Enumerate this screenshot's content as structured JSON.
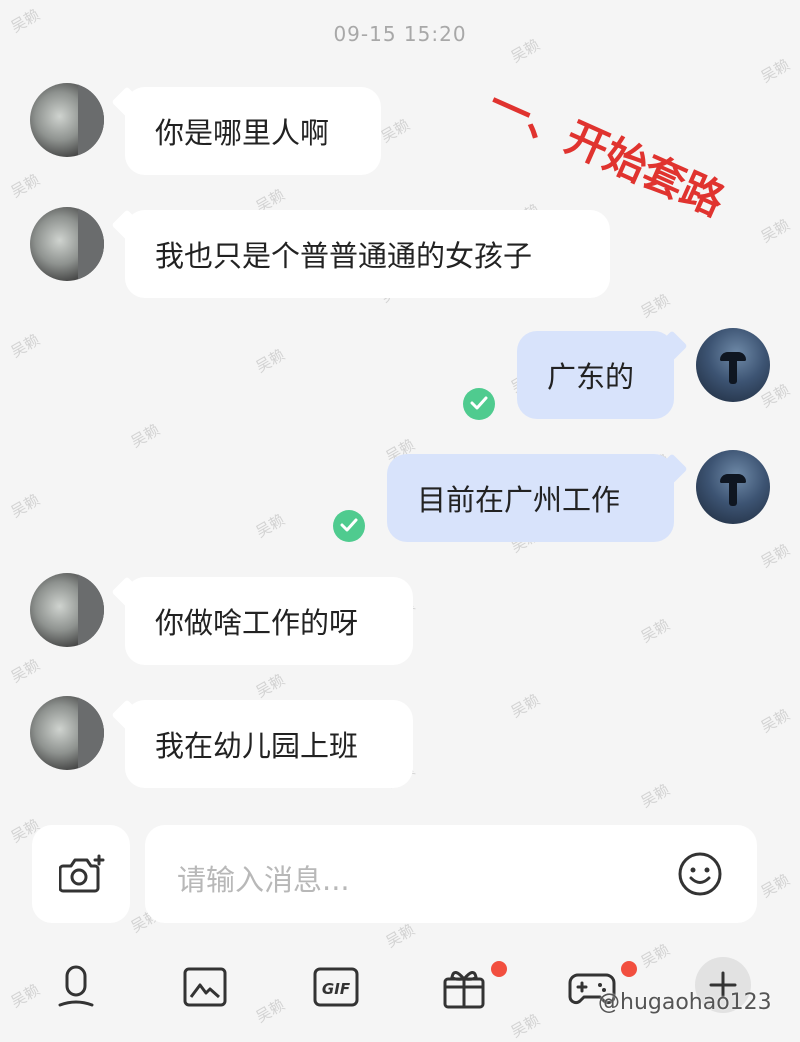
{
  "chat": {
    "timestamp": "09-15 15:20",
    "messages": [
      {
        "from": "them",
        "text": "你是哪里人啊"
      },
      {
        "from": "them",
        "text": "我也只是个普普通通的女孩子"
      },
      {
        "from": "me",
        "text": "广东的",
        "status": "read"
      },
      {
        "from": "me",
        "text": "目前在广州工作",
        "status": "read"
      },
      {
        "from": "them",
        "text": "你做啥工作的呀"
      },
      {
        "from": "them",
        "text": "我在幼儿园上班"
      }
    ]
  },
  "annotation": "一、开始套路",
  "watermark": "吴赖",
  "input": {
    "placeholder": "请输入消息..."
  },
  "toolbar": {
    "items": [
      {
        "icon": "microphone-icon"
      },
      {
        "icon": "image-icon"
      },
      {
        "icon": "gif-icon",
        "label": "GIF"
      },
      {
        "icon": "gift-icon",
        "badge": true
      },
      {
        "icon": "game-controller-icon",
        "badge": true
      },
      {
        "icon": "plus-icon"
      }
    ]
  },
  "credit": "@hugaohao123",
  "colors": {
    "outgoing_bubble": "#d8e3fb",
    "incoming_bubble": "#ffffff",
    "read_check": "#4fcb8f",
    "badge": "#f24f3f",
    "annotation": "#e0332f"
  }
}
